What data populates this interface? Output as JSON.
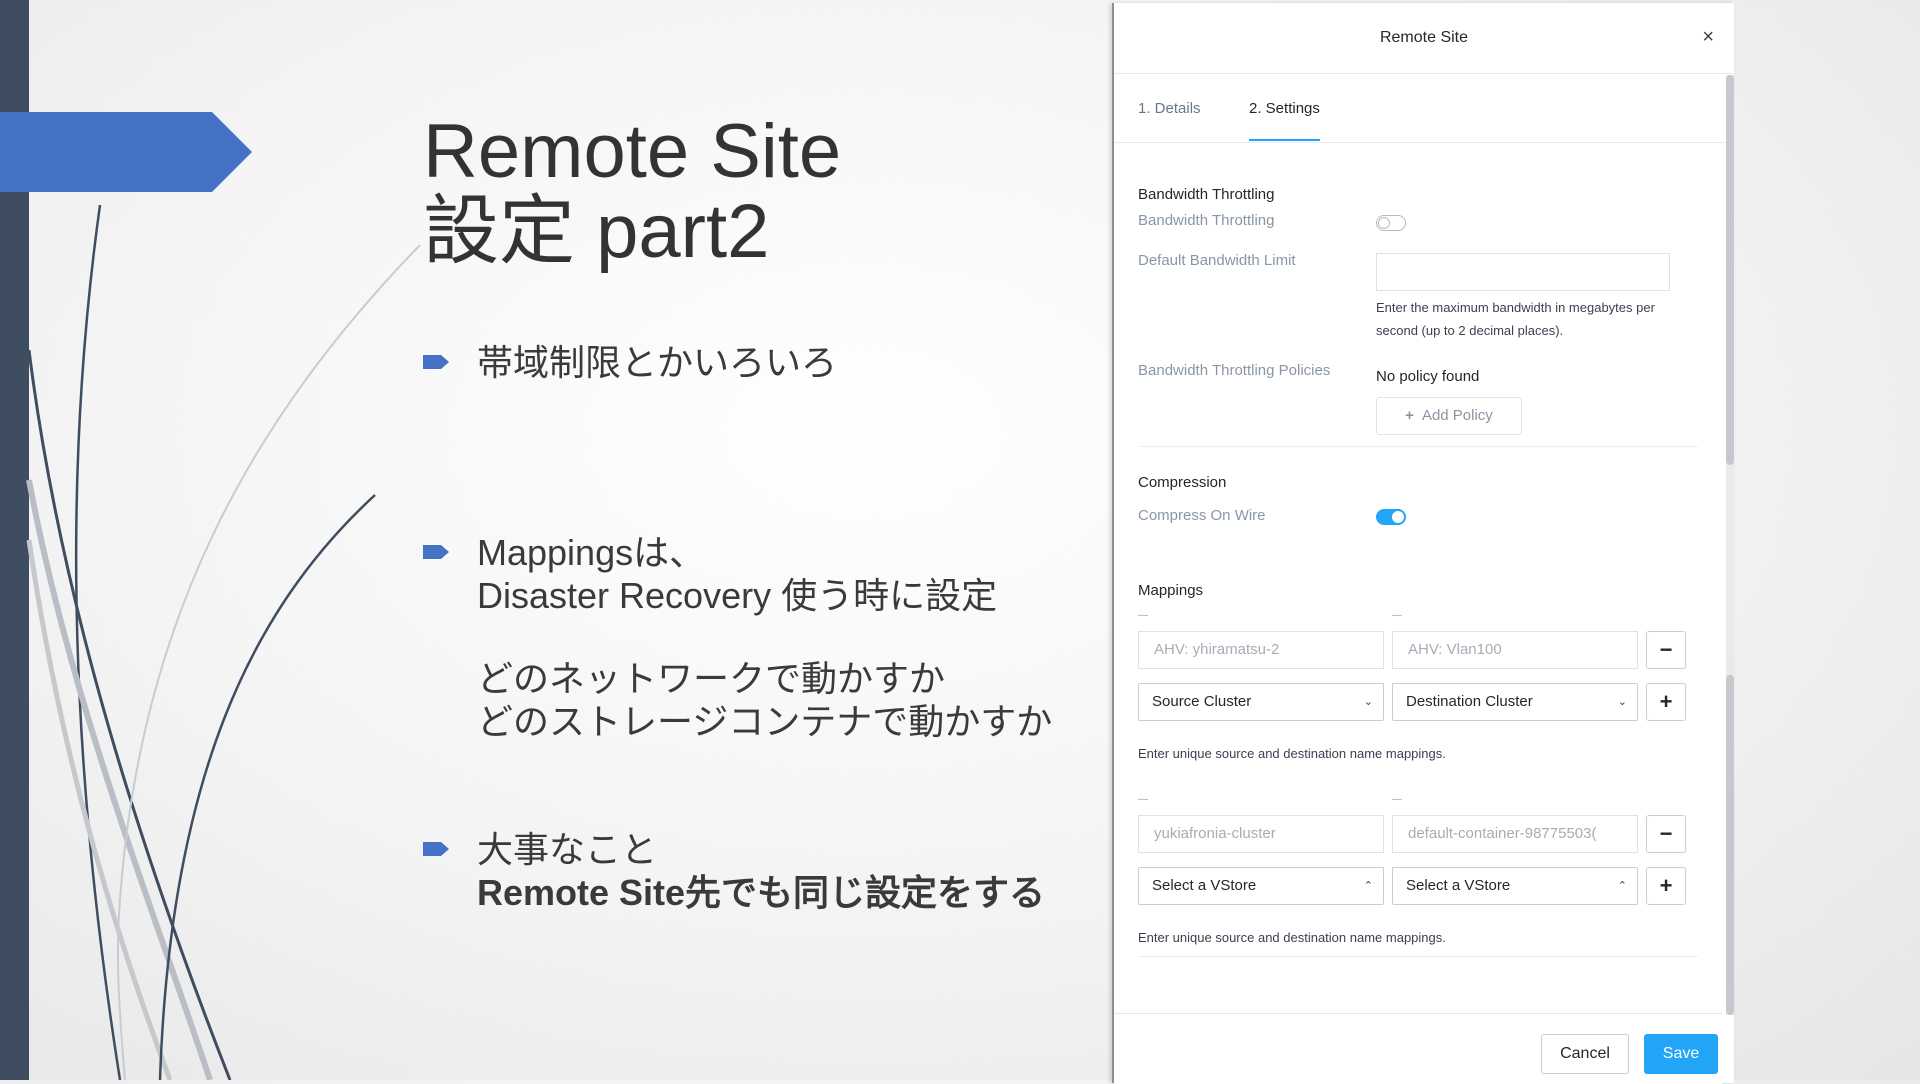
{
  "slide": {
    "title_line1": "Remote Site",
    "title_line2": "設定 part2",
    "bullets": [
      {
        "lines": [
          "帯域制限とかいろいろ"
        ]
      },
      {
        "lines": [
          "Mappingsは、",
          "Disaster Recovery 使う時に設定"
        ],
        "extra_lines": [
          "どのネットワークで動かすか",
          "どのストレージコンテナで動かすか"
        ]
      },
      {
        "lines": [
          "大事なこと"
        ],
        "bold_line": "Remote Site先でも同じ設定をする"
      }
    ],
    "accent_color": "#4472c4"
  },
  "dialog": {
    "title": "Remote Site",
    "close_icon": "×",
    "tabs": [
      {
        "label": "1. Details",
        "active": false
      },
      {
        "label": "2. Settings",
        "active": true
      }
    ],
    "bandwidth": {
      "section_title": "Bandwidth Throttling",
      "toggle_label": "Bandwidth Throttling",
      "toggle_on": false,
      "limit_label": "Default Bandwidth Limit",
      "limit_value": "",
      "limit_help": "Enter the maximum bandwidth in megabytes per second (up to 2 decimal places).",
      "policies_label": "Bandwidth Throttling Policies",
      "policies_value": "No policy found",
      "add_policy_label": "Add Policy"
    },
    "compression": {
      "section_title": "Compression",
      "toggle_label": "Compress On Wire",
      "toggle_on": true
    },
    "mappings": {
      "section_title": "Mappings",
      "network": {
        "source_value": "AHV: yhiramatsu-2",
        "dest_value": "AHV: Vlan100",
        "source_select": "Source Cluster",
        "dest_select": "Destination Cluster",
        "help": "Enter unique source and destination name mappings."
      },
      "storage": {
        "source_value": "yukiafronia-cluster",
        "dest_value": "default-container-98775503(",
        "source_select": "Select a VStore",
        "dest_select": "Select a VStore",
        "help": "Enter unique source and destination name mappings."
      },
      "remove_icon": "−",
      "add_icon": "+",
      "chevron_down": "⌄",
      "chevron_up": "⌃",
      "dash": "—"
    },
    "footer": {
      "cancel_label": "Cancel",
      "save_label": "Save"
    },
    "accent_color": "#22a5f7"
  }
}
